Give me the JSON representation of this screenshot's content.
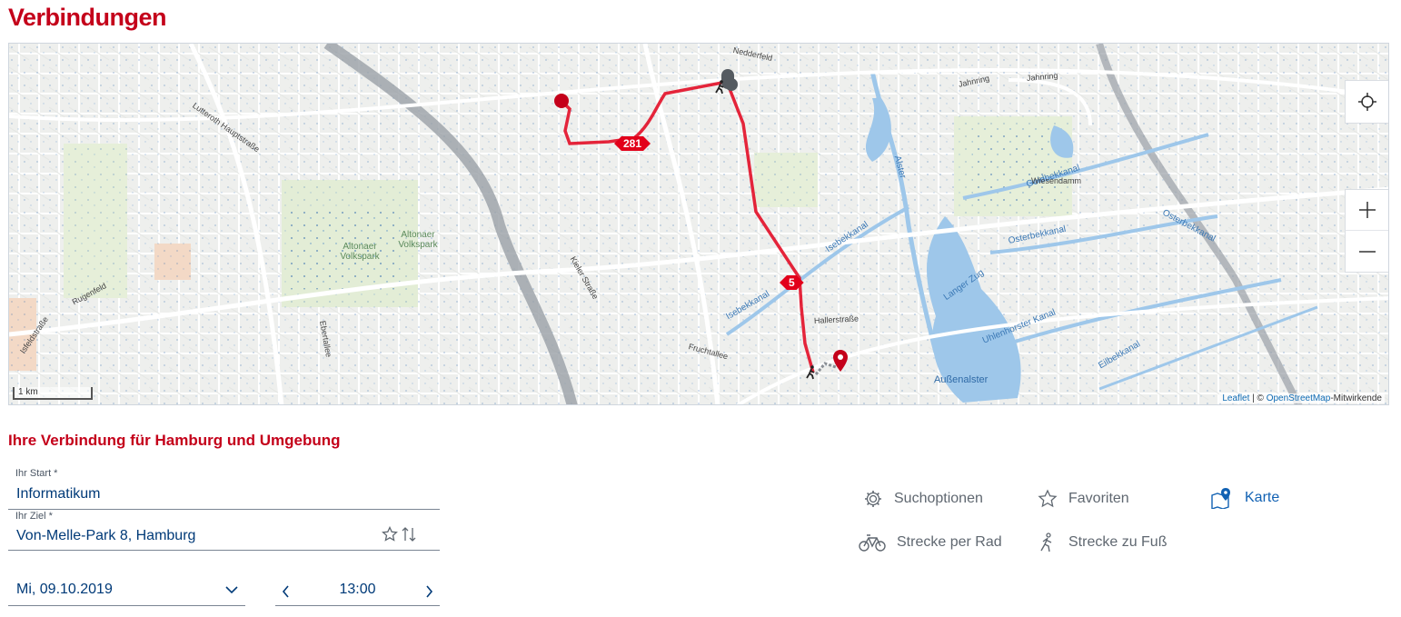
{
  "page": {
    "title": "Verbindungen",
    "section_title": "Ihre Verbindung für Hamburg und Umgebung"
  },
  "map": {
    "streets": [
      "Nedderfeld",
      "Lutteroth Hauptstraße",
      "Jahnring",
      "Jahnring",
      "Kieler Straße",
      "Rugenfeld",
      "Isfeldstraße",
      "Ebertallee",
      "Fruchtallee",
      "Hallerstraße"
    ],
    "waters": [
      "Goldbekkanal",
      "Osterbekkanal",
      "Osterbekkanal",
      "Isebekkanal",
      "Isebekkanal",
      "Uhlenhorster Kanal",
      "Eilbekkanal",
      "Langer Zug",
      "Alster"
    ],
    "misc_labels": [
      "Wiesendamm"
    ],
    "parks": [
      "Altonaer Volkspark",
      "Altonaer Volkspark"
    ],
    "lake": "Außenalster",
    "route_badges": [
      "281",
      "5"
    ],
    "scale": "1 km",
    "attribution": {
      "leaflet": "Leaflet",
      "separator": " | © ",
      "osm": "OpenStreetMap",
      "suffix": "-Mitwirkende"
    },
    "route_color": "#e2001a"
  },
  "form": {
    "start": {
      "label": "Ihr Start *",
      "value": "Informatikum"
    },
    "goal": {
      "label": "Ihr Ziel *",
      "value": "Von-Melle-Park 8, Hamburg"
    },
    "date": "Mi, 09.10.2019",
    "time": "13:00"
  },
  "actions": [
    {
      "label": "Suchoptionen",
      "icon": "gear-icon"
    },
    {
      "label": "Favoriten",
      "icon": "star-icon"
    },
    {
      "label": "Karte",
      "icon": "map-pin-icon"
    },
    {
      "label": "Strecke per Rad",
      "icon": "bicycle-icon"
    },
    {
      "label": "Strecke zu Fuß",
      "icon": "walking-icon"
    }
  ],
  "colors": {
    "brand_red": "#c4001a",
    "link_blue": "#1161b3",
    "text_blue": "#003a78"
  }
}
